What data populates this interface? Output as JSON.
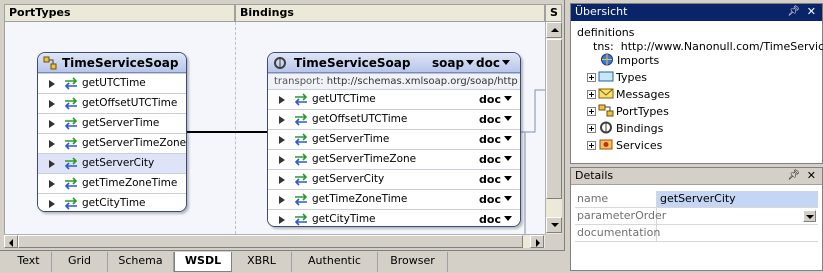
{
  "design": {
    "headers": {
      "port_types": "PortTypes",
      "bindings": "Bindings",
      "services": "S"
    },
    "port_type": {
      "name": "TimeServiceSoap",
      "operations": [
        {
          "name": "getUTCTime"
        },
        {
          "name": "getOffsetUTCTime"
        },
        {
          "name": "getServerTime"
        },
        {
          "name": "getServerTimeZone"
        },
        {
          "name": "getServerCity",
          "selected": true
        },
        {
          "name": "getTimeZoneTime"
        },
        {
          "name": "getCityTime"
        }
      ]
    },
    "binding": {
      "name": "TimeServiceSoap",
      "protocol": "soap",
      "style": "doc",
      "transport_label": "transport:",
      "transport_value": "http://schemas.xmlsoap.org/soap/http",
      "operations": [
        {
          "name": "getUTCTime",
          "style": "doc"
        },
        {
          "name": "getOffsetUTCTime",
          "style": "doc"
        },
        {
          "name": "getServerTime",
          "style": "doc"
        },
        {
          "name": "getServerTimeZone",
          "style": "doc"
        },
        {
          "name": "getServerCity",
          "style": "doc"
        },
        {
          "name": "getTimeZoneTime",
          "style": "doc"
        },
        {
          "name": "getCityTime",
          "style": "doc"
        }
      ]
    },
    "tabs": [
      "Text",
      "Grid",
      "Schema",
      "WSDL",
      "XBRL",
      "Authentic",
      "Browser"
    ],
    "active_tab": "WSDL"
  },
  "overview": {
    "title": "Übersicht",
    "definitions": "definitions",
    "tns_label": "tns:",
    "tns_value": "http://www.Nanonull.com/TimeService/",
    "items": [
      "Imports",
      "Types",
      "Messages",
      "PortTypes",
      "Bindings",
      "Services"
    ]
  },
  "details": {
    "title": "Details",
    "rows": [
      {
        "key": "name",
        "value": "getServerCity"
      },
      {
        "key": "parameterOrder",
        "value": ""
      },
      {
        "key": "documentation",
        "value": ""
      }
    ]
  },
  "icons": {
    "pin": "pin-icon",
    "close": "close-icon"
  },
  "colors": {
    "selection": "#0a246a",
    "box_title": "#b8c6ea",
    "selected_row": "#dfe3f7"
  }
}
